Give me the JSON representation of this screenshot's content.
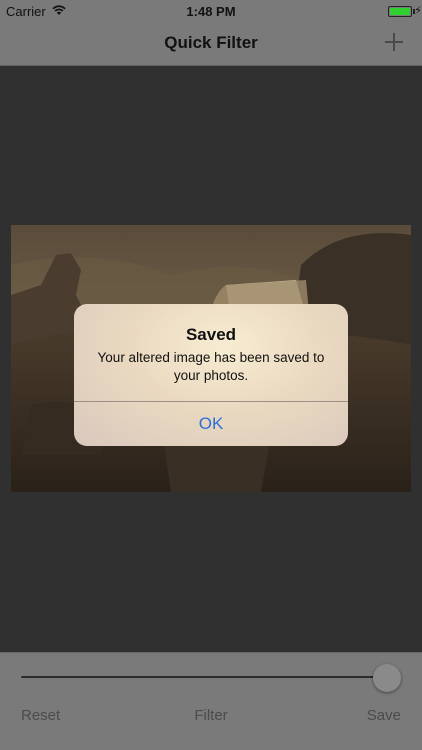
{
  "status_bar": {
    "carrier": "Carrier",
    "time": "1:48 PM",
    "battery_color": "#2fd02f"
  },
  "nav": {
    "title": "Quick Filter",
    "add_icon": "plus-icon"
  },
  "alert": {
    "title": "Saved",
    "message": "Your altered image has been saved to your photos.",
    "ok_label": "OK",
    "ok_color": "#2c6fd8"
  },
  "toolbar": {
    "slider_value": 1.0,
    "reset_label": "Reset",
    "filter_label": "Filter",
    "save_label": "Save"
  }
}
